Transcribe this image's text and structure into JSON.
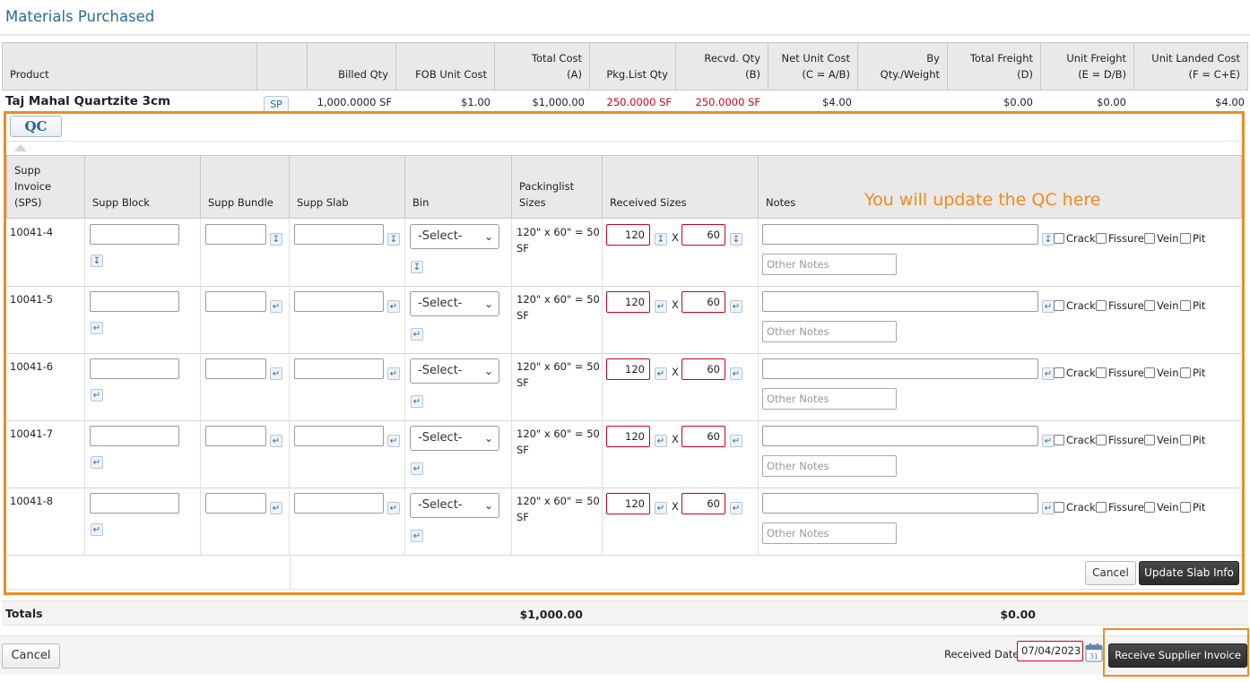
{
  "page": {
    "title": "Materials Purchased"
  },
  "main_table": {
    "headers": [
      {
        "line1": "",
        "line2": "Product"
      },
      {
        "line1": "",
        "line2": ""
      },
      {
        "line1": "",
        "line2": "Billed Qty"
      },
      {
        "line1": "",
        "line2": "FOB Unit Cost"
      },
      {
        "line1": "Total Cost",
        "line2": "(A)"
      },
      {
        "line1": "",
        "line2": "Pkg.List Qty"
      },
      {
        "line1": "Recvd. Qty",
        "line2": "(B)"
      },
      {
        "line1": "Net Unit Cost",
        "line2": "(C = A/B)"
      },
      {
        "line1": "By",
        "line2": "Qty./Weight"
      },
      {
        "line1": "Total Freight",
        "line2": "(D)"
      },
      {
        "line1": "Unit Freight",
        "line2": "(E = D/B)"
      },
      {
        "line1": "Unit Landed Cost",
        "line2": "(F = C+E)"
      }
    ],
    "product": {
      "name": "Taj Mahal Quartzite 3cm",
      "sp_button": "SP",
      "billed_qty": "1,000.0000 SF",
      "fob_unit_cost": "$1.00",
      "total_cost": "$1,000.00",
      "pkg_list_qty": "250.0000 SF",
      "recvd_qty": "250.0000 SF",
      "net_unit_cost": "$4.00",
      "total_freight": "$0.00",
      "unit_freight": "$0.00",
      "unit_landed_cost": "$4.00"
    }
  },
  "qc": {
    "button": "QC",
    "callout": "You will update the QC here",
    "headers": {
      "supp_invoice": [
        "Supp",
        "Invoice",
        "(SPS)"
      ],
      "supp_block": "Supp Block",
      "supp_bundle": "Supp Bundle",
      "supp_slab": "Supp Slab",
      "bin": "Bin",
      "packinglist": [
        "Packinglist",
        "Sizes"
      ],
      "received_sizes": "Received Sizes",
      "notes": "Notes"
    },
    "rows": [
      {
        "invoice": "10041-4",
        "bin": "-Select-",
        "size_line1": "120\" x 60\" = 50",
        "size_line2": "SF",
        "width": "120",
        "x": "X",
        "height": "60",
        "other_notes_placeholder": "Other Notes"
      },
      {
        "invoice": "10041-5",
        "bin": "-Select-",
        "size_line1": "120\" x 60\" = 50",
        "size_line2": "SF",
        "width": "120",
        "x": "X",
        "height": "60",
        "other_notes_placeholder": "Other Notes"
      },
      {
        "invoice": "10041-6",
        "bin": "-Select-",
        "size_line1": "120\" x 60\" = 50",
        "size_line2": "SF",
        "width": "120",
        "x": "X",
        "height": "60",
        "other_notes_placeholder": "Other Notes"
      },
      {
        "invoice": "10041-7",
        "bin": "-Select-",
        "size_line1": "120\" x 60\" = 50",
        "size_line2": "SF",
        "width": "120",
        "x": "X",
        "height": "60",
        "other_notes_placeholder": "Other Notes"
      },
      {
        "invoice": "10041-8",
        "bin": "-Select-",
        "size_line1": "120\" x 60\" = 50",
        "size_line2": "SF",
        "width": "120",
        "x": "X",
        "height": "60",
        "other_notes_placeholder": "Other Notes"
      }
    ],
    "checks": [
      "Crack",
      "Fissure",
      "Vein",
      "Pit"
    ],
    "cancel": "Cancel",
    "update": "Update Slab Info"
  },
  "totals": {
    "label": "Totals",
    "total_cost": "$1,000.00",
    "total_freight": "$0.00"
  },
  "footer": {
    "cancel": "Cancel",
    "received_date_label": "Received Date:",
    "received_date": "07/04/2023",
    "receive_button": "Receive Supplier Invoice"
  },
  "colors": {
    "accent_orange": "#f28a1e",
    "title_blue": "#2b6a9b",
    "error_red": "#d0001c"
  }
}
